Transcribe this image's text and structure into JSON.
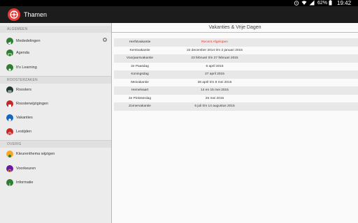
{
  "status_bar": {
    "battery": "62%",
    "time": "19:42",
    "icons": [
      "alarm-icon",
      "wifi-icon",
      "signal-icon",
      "battery-icon"
    ]
  },
  "app": {
    "title": "Thamen",
    "accent_color": "#e53935"
  },
  "drawer": {
    "section_general": "ALGEMEEN",
    "section_schedule": "ROOSTERZAKEN",
    "section_other": "OVERIG",
    "items": [
      {
        "label": "Mededelingen",
        "icon": "megaphone-icon",
        "color": "#2e7d32"
      },
      {
        "label": "Agenda",
        "icon": "calendar-icon",
        "color": "#2e7d32"
      },
      {
        "label": "It's Learning",
        "icon": "learning-icon",
        "color": "#2e7d32"
      },
      {
        "label": "Roosters",
        "icon": "grid-icon",
        "color": "#1e3a2e"
      },
      {
        "label": "Roosterwijzigingen",
        "icon": "change-icon",
        "color": "#c62828"
      },
      {
        "label": "Vakanties",
        "icon": "sun-icon",
        "color": "#1565c0"
      },
      {
        "label": "Lestijden",
        "icon": "clock-icon",
        "color": "#c62828"
      },
      {
        "label": "Kleurenthema wijzigen",
        "icon": "palette-icon",
        "color": "#f9a825"
      },
      {
        "label": "Voorkeuren",
        "icon": "settings-icon",
        "color": "#6a1b9a"
      },
      {
        "label": "Informatie",
        "icon": "info-icon",
        "color": "#2e7d32"
      }
    ]
  },
  "content": {
    "title": "Vakanties & Vrije Dagen",
    "vacations": [
      {
        "name": "Herfstvakantie",
        "dates": "Recent Afgelopen",
        "highlight": true
      },
      {
        "name": "Kerstvakantie",
        "dates": "22 december 2014 t/m 2 januari 2015",
        "highlight": false
      },
      {
        "name": "Voorjaarsvakantie",
        "dates": "23 februari t/m 27 februari 2015",
        "highlight": false
      },
      {
        "name": "2e Paasdag",
        "dates": "6 april 2015",
        "highlight": false
      },
      {
        "name": "Koningsdag",
        "dates": "27 april 2015",
        "highlight": false
      },
      {
        "name": "Meivakantie",
        "dates": "28 april t/m 8 mei 2015",
        "highlight": false
      },
      {
        "name": "Hemelvaart",
        "dates": "14 en 15 mei 2015",
        "highlight": false
      },
      {
        "name": "2e Pinksterdag",
        "dates": "25 mei 2015",
        "highlight": false
      },
      {
        "name": "Zomervakantie",
        "dates": "6 juli t/m 14 augustus 2015",
        "highlight": false
      }
    ]
  }
}
